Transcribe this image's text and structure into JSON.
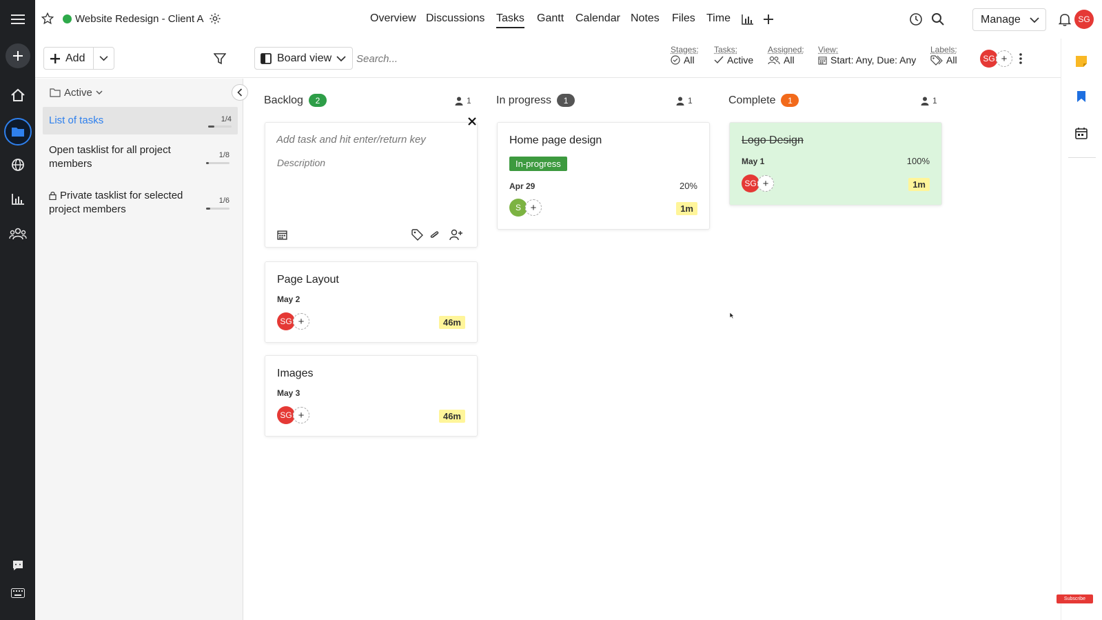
{
  "project": {
    "title": "Website Redesign - Client A",
    "status_color": "#2eaa4a"
  },
  "nav": {
    "tabs": [
      {
        "label": "Overview"
      },
      {
        "label": "Discussions"
      },
      {
        "label": "Tasks",
        "selected": true
      },
      {
        "label": "Gantt"
      },
      {
        "label": "Calendar"
      },
      {
        "label": "Notes"
      },
      {
        "label": "Files"
      },
      {
        "label": "Time"
      }
    ],
    "manage_label": "Manage",
    "user_initials": "SG"
  },
  "toolbar": {
    "add_label": "Add",
    "view_label": "Board view",
    "search_placeholder": "Search...",
    "filters": {
      "stages": {
        "label": "Stages:",
        "value": "All"
      },
      "tasks": {
        "label": "Tasks:",
        "value": "Active"
      },
      "assigned": {
        "label": "Assigned:",
        "value": "All"
      },
      "view": {
        "label": "View:",
        "value": "Start: Any, Due: Any"
      },
      "labels": {
        "label": "Labels:",
        "value": "All"
      }
    },
    "member_initials": "SG"
  },
  "sidebar": {
    "filter_label": "Active",
    "tasklists": [
      {
        "name": "List of tasks",
        "count": "1/4",
        "progress": 0.25,
        "selected": true
      },
      {
        "name": "Open tasklist for all project members",
        "count": "1/8",
        "progress": 0.125
      },
      {
        "name": "Private tasklist for selected project members",
        "count": "1/6",
        "progress": 0.17,
        "private": true
      }
    ]
  },
  "board": {
    "columns": [
      {
        "title": "Backlog",
        "count": "2",
        "badge_color": "#2e9e48",
        "members": "1"
      },
      {
        "title": "In progress",
        "count": "1",
        "badge_color": "#555555",
        "members": "1"
      },
      {
        "title": "Complete",
        "count": "1",
        "badge_color": "#f26a1b",
        "members": "1"
      }
    ],
    "new_task": {
      "placeholder": "Add task and hit enter/return key",
      "description_placeholder": "Description"
    },
    "cards": {
      "page_layout": {
        "title": "Page Layout",
        "date": "May 2",
        "assignee": "SG",
        "time": "46m"
      },
      "images": {
        "title": "Images",
        "date": "May 3",
        "assignee": "SG",
        "time": "46m"
      },
      "home_page": {
        "title": "Home page design",
        "stage": "In-progress",
        "date": "Apr 29",
        "percent": "20%",
        "assignee": "S",
        "time": "1m"
      },
      "logo_design": {
        "title": "Logo Design",
        "date": "May 1",
        "percent": "100%",
        "assignee": "SG",
        "time": "1m"
      }
    }
  },
  "footer": {
    "subscribe_label": "Subscribe"
  }
}
